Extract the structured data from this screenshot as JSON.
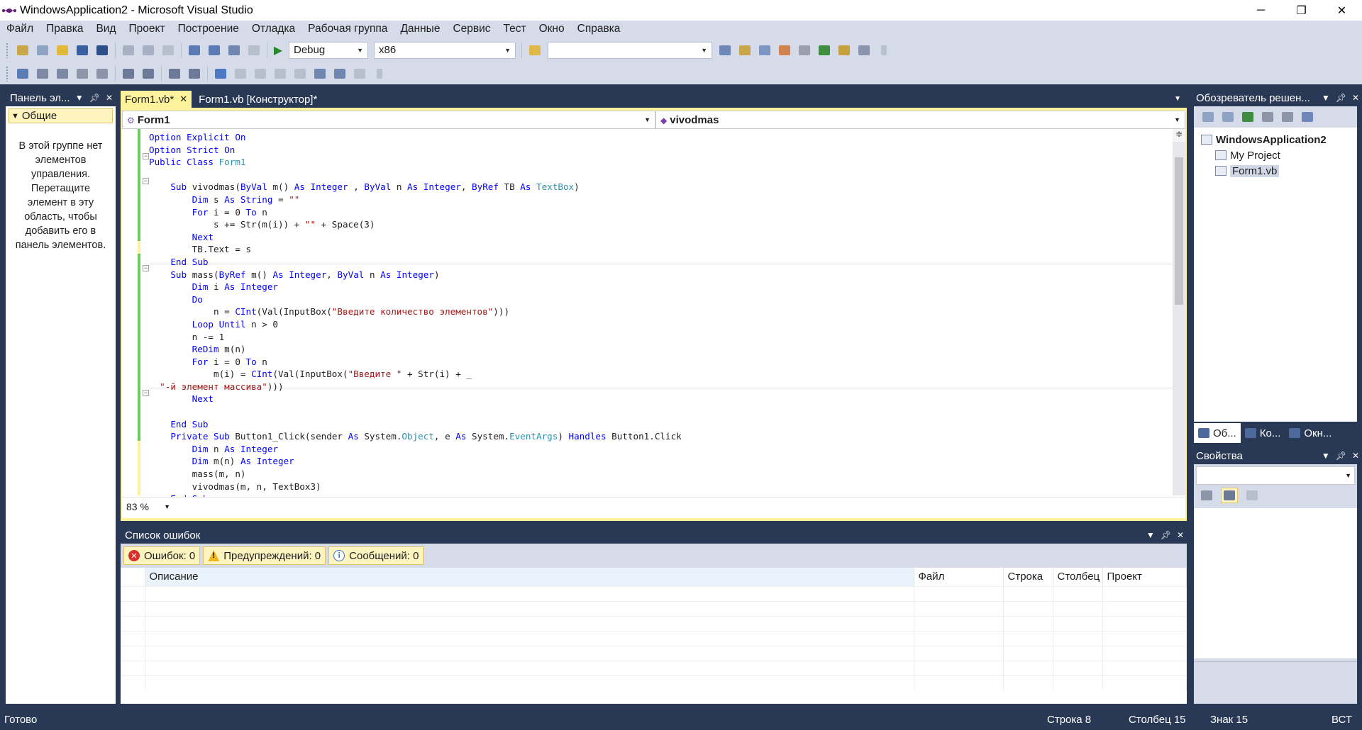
{
  "window": {
    "title": "WindowsApplication2 - Microsoft Visual Studio",
    "minimize": "─",
    "restore": "❐",
    "close": "✕"
  },
  "menu": [
    "Файл",
    "Правка",
    "Вид",
    "Проект",
    "Построение",
    "Отладка",
    "Рабочая группа",
    "Данные",
    "Сервис",
    "Тест",
    "Окно",
    "Справка"
  ],
  "toolbar": {
    "configuration": "Debug",
    "platform": "x86",
    "search_value": ""
  },
  "toolbox": {
    "title": "Панель эл...",
    "group": "Общие",
    "empty_message": "В этой группе нет элементов управления. Перетащите элемент в эту область, чтобы добавить его в панель элементов."
  },
  "editor": {
    "tabs": [
      {
        "label": "Form1.vb*",
        "active": true
      },
      {
        "label": "Form1.vb [Конструктор]*",
        "active": false
      }
    ],
    "class_dropdown": "Form1",
    "method_dropdown": "vivodmas",
    "zoom": "83 %",
    "lines": [
      [
        [
          "kw",
          "Option Explicit On"
        ]
      ],
      [
        [
          "kw",
          "Option Strict On"
        ]
      ],
      [
        [
          "kw",
          "Public Class "
        ],
        [
          "ty",
          "Form1"
        ]
      ],
      [
        [
          "",
          ""
        ]
      ],
      [
        [
          "",
          "    "
        ],
        [
          "kw",
          "Sub "
        ],
        [
          "",
          "vivodmas("
        ],
        [
          "kw",
          "ByVal "
        ],
        [
          "",
          "m() "
        ],
        [
          "kw",
          "As Integer"
        ],
        [
          "",
          " , "
        ],
        [
          "kw",
          "ByVal "
        ],
        [
          "",
          "n "
        ],
        [
          "kw",
          "As Integer"
        ],
        [
          "",
          ", "
        ],
        [
          "kw",
          "ByRef "
        ],
        [
          "",
          "TB "
        ],
        [
          "kw",
          "As "
        ],
        [
          "ty",
          "TextBox"
        ],
        [
          "",
          ")"
        ]
      ],
      [
        [
          "",
          "        "
        ],
        [
          "kw",
          "Dim "
        ],
        [
          "",
          "s "
        ],
        [
          "kw",
          "As String"
        ],
        [
          "",
          " = "
        ],
        [
          "st",
          "\"\""
        ]
      ],
      [
        [
          "",
          "        "
        ],
        [
          "kw",
          "For "
        ],
        [
          "",
          "i = 0 "
        ],
        [
          "kw",
          "To "
        ],
        [
          "",
          "n"
        ]
      ],
      [
        [
          "",
          "            s += Str(m(i)) + "
        ],
        [
          "st",
          "\"\""
        ],
        [
          "",
          " + Space(3)"
        ]
      ],
      [
        [
          "",
          "        "
        ],
        [
          "kw",
          "Next"
        ]
      ],
      [
        [
          "",
          "        TB.Text = s"
        ]
      ],
      [
        [
          "",
          "    "
        ],
        [
          "kw",
          "End Sub"
        ]
      ],
      [
        [
          "",
          "    "
        ],
        [
          "kw",
          "Sub "
        ],
        [
          "",
          "mass("
        ],
        [
          "kw",
          "ByRef "
        ],
        [
          "",
          "m() "
        ],
        [
          "kw",
          "As Integer"
        ],
        [
          "",
          ", "
        ],
        [
          "kw",
          "ByVal "
        ],
        [
          "",
          "n "
        ],
        [
          "kw",
          "As Integer"
        ],
        [
          "",
          ")"
        ]
      ],
      [
        [
          "",
          "        "
        ],
        [
          "kw",
          "Dim "
        ],
        [
          "",
          "i "
        ],
        [
          "kw",
          "As Integer"
        ]
      ],
      [
        [
          "",
          "        "
        ],
        [
          "kw",
          "Do"
        ]
      ],
      [
        [
          "",
          "            n = "
        ],
        [
          "kw",
          "CInt"
        ],
        [
          "",
          "(Val(InputBox("
        ],
        [
          "st",
          "\"Введите количество элементов\""
        ],
        [
          "",
          ")))"
        ]
      ],
      [
        [
          "",
          "        "
        ],
        [
          "kw",
          "Loop Until "
        ],
        [
          "",
          "n > 0"
        ]
      ],
      [
        [
          "",
          "        n -= 1"
        ]
      ],
      [
        [
          "",
          "        "
        ],
        [
          "kw",
          "ReDim "
        ],
        [
          "",
          "m(n)"
        ]
      ],
      [
        [
          "",
          "        "
        ],
        [
          "kw",
          "For "
        ],
        [
          "",
          "i = 0 "
        ],
        [
          "kw",
          "To "
        ],
        [
          "",
          "n"
        ]
      ],
      [
        [
          "",
          "            m(i) = "
        ],
        [
          "kw",
          "CInt"
        ],
        [
          "",
          "(Val(InputBox("
        ],
        [
          "st",
          "\"Введите \""
        ],
        [
          "",
          " + Str(i) + _"
        ]
      ],
      [
        [
          "",
          "  "
        ],
        [
          "st",
          "\"-й элемент массива\""
        ],
        [
          "",
          ")))"
        ]
      ],
      [
        [
          "",
          "        "
        ],
        [
          "kw",
          "Next"
        ]
      ],
      [
        [
          "",
          ""
        ]
      ],
      [
        [
          "",
          "    "
        ],
        [
          "kw",
          "End Sub"
        ]
      ],
      [
        [
          "",
          "    "
        ],
        [
          "kw",
          "Private Sub "
        ],
        [
          "",
          "Button1_Click(sender "
        ],
        [
          "kw",
          "As "
        ],
        [
          "",
          "System."
        ],
        [
          "ty",
          "Object"
        ],
        [
          "",
          ", e "
        ],
        [
          "kw",
          "As "
        ],
        [
          "",
          "System."
        ],
        [
          "ty",
          "EventArgs"
        ],
        [
          "",
          ") "
        ],
        [
          "kw",
          "Handles "
        ],
        [
          "",
          "Button1.Click"
        ]
      ],
      [
        [
          "",
          "        "
        ],
        [
          "kw",
          "Dim "
        ],
        [
          "",
          "n "
        ],
        [
          "kw",
          "As Integer"
        ]
      ],
      [
        [
          "",
          "        "
        ],
        [
          "kw",
          "Dim "
        ],
        [
          "",
          "m(n) "
        ],
        [
          "kw",
          "As Integer"
        ]
      ],
      [
        [
          "",
          "        mass(m, n)"
        ]
      ],
      [
        [
          "",
          "        vivodmas(m, n, TextBox3)"
        ]
      ],
      [
        [
          "",
          "    "
        ],
        [
          "kw",
          "End Sub"
        ]
      ]
    ]
  },
  "error_list": {
    "title": "Список ошибок",
    "errors": "Ошибок: 0",
    "warnings": "Предупреждений: 0",
    "messages": "Сообщений: 0",
    "columns": [
      "Описание",
      "Файл",
      "Строка",
      "Столбец",
      "Проект"
    ]
  },
  "solution_explorer": {
    "title": "Обозреватель решен...",
    "items": [
      "WindowsApplication2",
      "My Project",
      "Form1.vb"
    ],
    "tabs": [
      "Об...",
      "Ко...",
      "Окн..."
    ]
  },
  "properties": {
    "title": "Свойства"
  },
  "status": {
    "ready": "Готово",
    "line": "Строка 8",
    "column": "Столбец 15",
    "char": "Знак 15",
    "mode": "ВСТ"
  }
}
